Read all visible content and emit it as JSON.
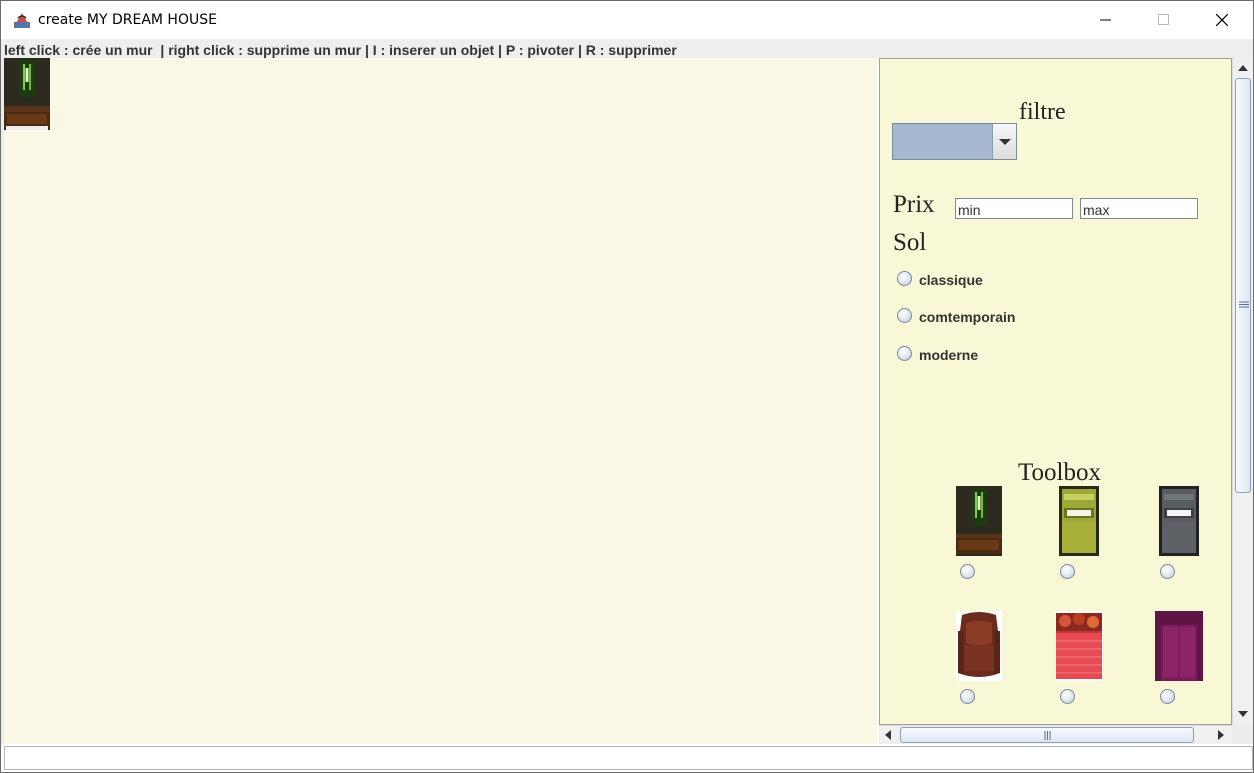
{
  "window": {
    "title": "create MY DREAM HOUSE",
    "controls": [
      "minimize",
      "maximize",
      "close"
    ]
  },
  "instructions": "left click : crée un mur  | right click : supprime un mur | I : inserer un objet | P : pivoter | R : supprimer",
  "canvas": {
    "background": "#faf8e5",
    "placed_objects": [
      {
        "type": "wardrobe-dark",
        "icon": "wardrobe-icon"
      }
    ]
  },
  "panel": {
    "filter_label": "filtre",
    "filter_selected": "",
    "price_label": "Prix",
    "price_min_value": "min",
    "price_max_value": "max",
    "sol_label": "Sol",
    "sol_options": [
      "classique",
      "comtemporain",
      "moderne"
    ],
    "toolbox_label": "Toolbox",
    "toolbox_items": [
      {
        "icon": "dark-wardrobe-icon"
      },
      {
        "icon": "green-bed-icon"
      },
      {
        "icon": "grey-bed-icon"
      },
      {
        "icon": "brown-armchair-icon"
      },
      {
        "icon": "red-bed-icon"
      },
      {
        "icon": "purple-sofa-icon"
      }
    ]
  },
  "colors": {
    "panel_bg": "#f8f7d6",
    "combo_bg": "#a6b8cf",
    "canvas_bg": "#faf8e5"
  }
}
